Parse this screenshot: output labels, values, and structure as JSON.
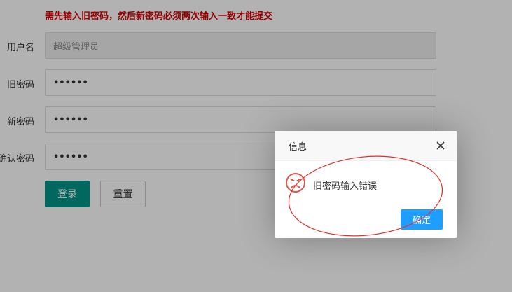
{
  "form": {
    "hint": "需先输入旧密码，然后新密码必须两次输入一致才能提交",
    "username_label": "用户名",
    "username_value": "超级管理员",
    "old_password_label": "旧密码",
    "old_password_value": "••••••",
    "new_password_label": "新密码",
    "new_password_value": "••••••",
    "confirm_password_label": "确认密码",
    "confirm_password_value": "••••••",
    "submit_label": "登录",
    "reset_label": "重置"
  },
  "dialog": {
    "title": "信息",
    "message": "旧密码输入错误",
    "ok_label": "确定",
    "icon": "sad-face-icon"
  },
  "colors": {
    "hint": "#d40000",
    "primary_button": "#009688",
    "ok_button": "#1e9fff",
    "annotation": "#e03030",
    "icon": "#e2574c"
  }
}
